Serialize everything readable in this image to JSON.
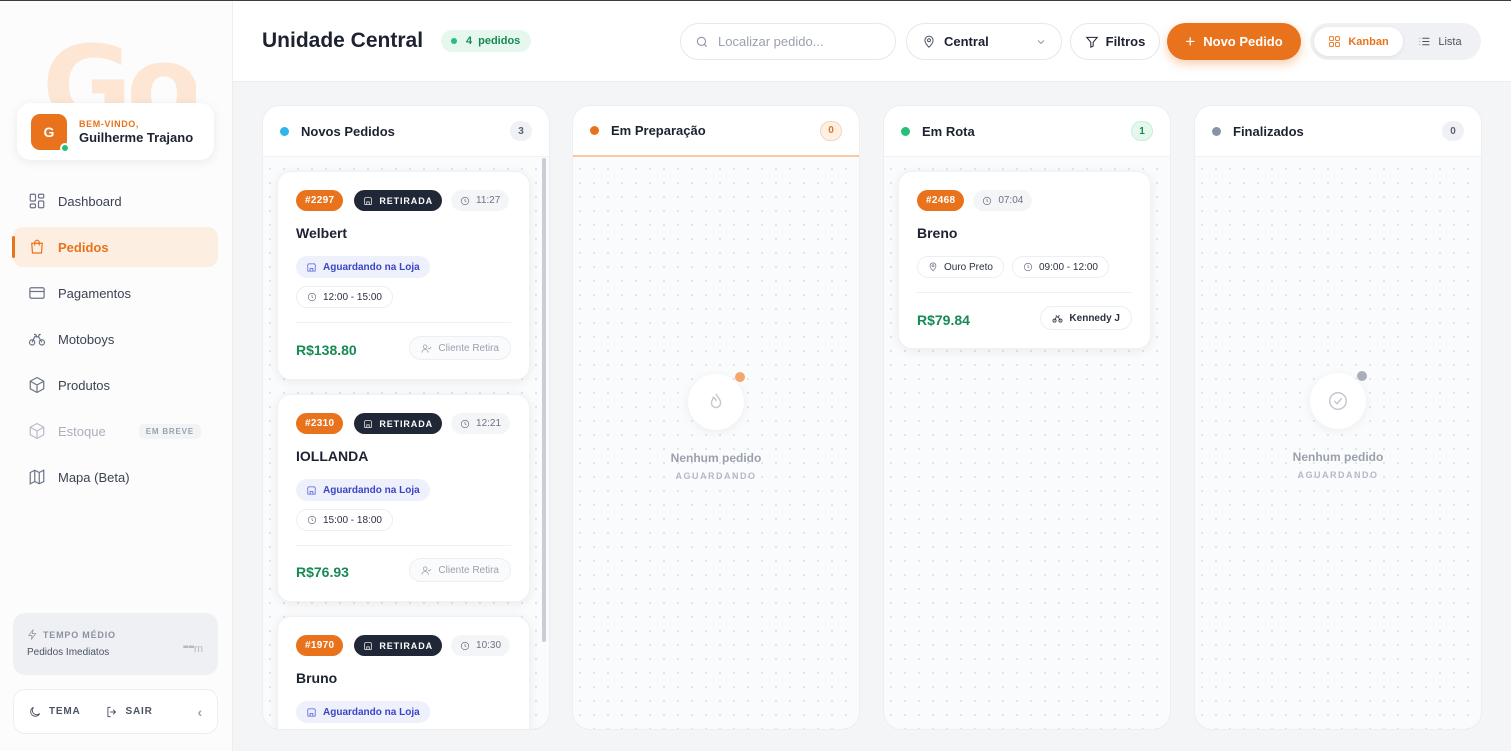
{
  "sidebar": {
    "brand_watermark": "Go",
    "user": {
      "initial": "G",
      "welcome": "BEM-VINDO,",
      "name": "Guilherme Trajano"
    },
    "items": [
      {
        "label": "Dashboard",
        "icon": "dashboard-icon"
      },
      {
        "label": "Pedidos",
        "icon": "bag-icon",
        "active": true
      },
      {
        "label": "Pagamentos",
        "icon": "card-icon"
      },
      {
        "label": "Motoboys",
        "icon": "bike-icon"
      },
      {
        "label": "Produtos",
        "icon": "box-icon"
      },
      {
        "label": "Estoque",
        "icon": "cube-icon",
        "badge": "EM BREVE",
        "disabled": true
      },
      {
        "label": "Mapa (Beta)",
        "icon": "map-icon"
      }
    ],
    "avg": {
      "title": "TEMPO MÉDIO",
      "subtitle": "Pedidos Imediatos",
      "value": "--",
      "unit": "m"
    },
    "footer": {
      "theme": "TEMA",
      "logout": "SAIR",
      "collapse": "‹"
    }
  },
  "header": {
    "title": "Unidade Central",
    "order_count": "4",
    "order_count_label": "pedidos",
    "search_placeholder": "Localizar pedido...",
    "unit": "Central",
    "filters": "Filtros",
    "new_order": "Novo Pedido",
    "view_kanban": "Kanban",
    "view_list": "Lista"
  },
  "columns": [
    {
      "title": "Novos Pedidos",
      "count": "3",
      "color": "#2fb5ea",
      "cards": [
        {
          "id": "#2297",
          "type": "RETIRADA",
          "time": "11:27",
          "customer": "Welbert",
          "status": "Aguardando na Loja",
          "window": "12:00 - 15:00",
          "price": "R$138.80",
          "action": "Cliente Retira"
        },
        {
          "id": "#2310",
          "type": "RETIRADA",
          "time": "12:21",
          "customer": "IOLLANDA",
          "status": "Aguardando na Loja",
          "window": "15:00 - 18:00",
          "price": "R$76.93",
          "action": "Cliente Retira"
        },
        {
          "id": "#1970",
          "type": "RETIRADA",
          "time": "10:30",
          "customer": "Bruno",
          "status": "Aguardando na Loja"
        }
      ]
    },
    {
      "title": "Em Preparação",
      "count": "0",
      "color": "#e8731c",
      "empty": {
        "title": "Nenhum pedido",
        "subtitle": "AGUARDANDO"
      }
    },
    {
      "title": "Em Rota",
      "count": "1",
      "color": "#22c07a",
      "cards": [
        {
          "id": "#2468",
          "time": "07:04",
          "customer": "Breno",
          "location": "Ouro Preto",
          "window": "09:00 - 12:00",
          "price": "R$79.84",
          "courier": "Kennedy J"
        }
      ]
    },
    {
      "title": "Finalizados",
      "count": "0",
      "color": "#8a92a8",
      "empty": {
        "title": "Nenhum pedido",
        "subtitle": "AGUARDANDO"
      }
    }
  ],
  "colors": {
    "accent": "#e8731c",
    "success": "#178a54",
    "dark": "#202736"
  }
}
